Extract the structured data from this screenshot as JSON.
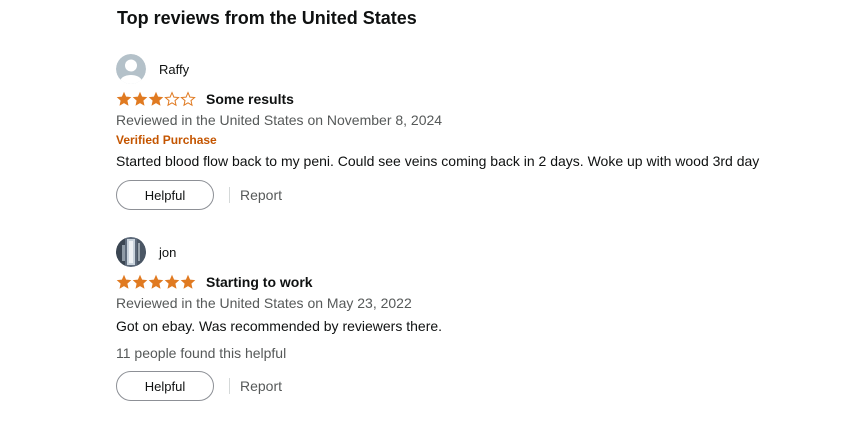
{
  "section": {
    "title": "Top reviews from the United States"
  },
  "colors": {
    "star": "#e07a21",
    "star_empty": "#e07a21",
    "verified": "#c45500",
    "muted": "#565959"
  },
  "reviews": [
    {
      "profile_name": "Raffy",
      "avatar_icon": "default-user-avatar-icon",
      "rating": 3,
      "title": "Some results",
      "date": "Reviewed in the United States on November 8, 2024",
      "verified": "Verified Purchase",
      "body": "Started blood flow back to my peni. Could see veins coming back in 2 days. Woke up with wood 3rd day",
      "helpful_count": "",
      "helpful_label": "Helpful",
      "report_label": "Report"
    },
    {
      "profile_name": "jon",
      "avatar_icon": "photo-avatar-icon",
      "rating": 5,
      "title": "Starting to work",
      "date": "Reviewed in the United States on May 23, 2022",
      "verified": "",
      "body": "Got on ebay. Was recommended by reviewers there.",
      "helpful_count": "11 people found this helpful",
      "helpful_label": "Helpful",
      "report_label": "Report"
    }
  ]
}
